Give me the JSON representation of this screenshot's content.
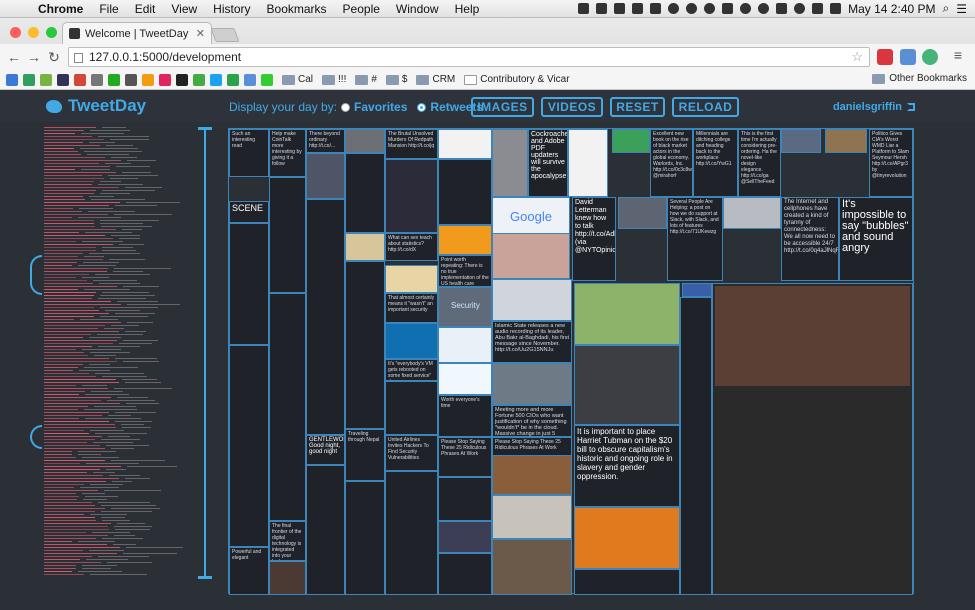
{
  "menubar": {
    "app": "Chrome",
    "items": [
      "File",
      "Edit",
      "View",
      "History",
      "Bookmarks",
      "People",
      "Window",
      "Help"
    ],
    "clock": "May 14  2:40 PM"
  },
  "browser": {
    "tab_title": "Welcome | TweetDay",
    "url": "127.0.0.1:5000/development",
    "bookmarks": [
      "Cal",
      "!!!",
      "#",
      "$",
      "CRM",
      "Contributory & Vicar"
    ],
    "other_bookmarks": "Other Bookmarks"
  },
  "app": {
    "logo": "TweetDay",
    "display_label": "Display your day by:",
    "option_favorites": "Favorites",
    "option_retweets": "Retweets",
    "buttons": [
      "IMAGES",
      "VIDEOS",
      "RESET",
      "RELOAD"
    ],
    "username": "danielsgriffin"
  },
  "tiles": {
    "t1": "Such an interesting read",
    "t2": "Help make CoinTalk more interesting by giving it a follow",
    "t3": "There beyond ordinary http://t.co/...",
    "t4": "The Brutal Unsolved Murders Of Redpath Mansion http://t.co/jq",
    "t5": "Cockroaches and Adobe PDF updaters will survive the apocalypse",
    "t6": "Excellent new book on the rise of black market actors in the global economy. Warlords, Inc. http://t.co/0c3c8w @mirahorf",
    "t7": "Millennials are ditching college and heading back to the workplace http://t.co/YwG1",
    "t8": "This is the first time I'm actually considering pre-ordering. Ha the novel-like design elegance. http://t.co/ga @SellTheFeed",
    "t9": "Politico Gives CIA's Worst WMD Liar a Platform to Slam Seymour Hersh http://t.co/APgr3 by @tinyrevolution",
    "t10": "David Letterman knew how to talk http://t.co/Adk (via @NYTOpinio",
    "t11": "Several People Are Helping: a post on how we do support at Slack, with Slack, and lots of features http://t.co/71UKewzg",
    "t12": "The Internet and cellphones have created a kind of tyranny of connectedness: We all now need to be accessible 24/7 http://t.co/0q4aJlNqR",
    "t13": "It's impossible to say \"bubbles\" and sound angry",
    "t14": "SCENE",
    "t15": "What can sex teach about statistics? http://t.co/dX",
    "t16": "Point worth repeating: There is no true implementation of the US health care system",
    "t17": "That almost certainly means it \"wasn't\" an important security",
    "t18": "Security",
    "t19": "Islamic State releases a new audio recording of its leader, Abu Bakr al-Baghdadi, his first message since November. http://t.co/Uu2G15NNJu",
    "t20": "It is important to place Harriet Tubman on the $20 bill to obscure capitalism's historic and ongoing role in slavery and gender oppression.",
    "t21": "Meeting more and more Fortune 500 CIOs who want justification of why something *wouldn't* be in the cloud. Massive change in just 5 years.",
    "t22": "Please Stop Saying These 25 Ridiculous Phrases At Work",
    "t23": "GENTLEWOM Good night, good night",
    "t24": "Worth everyone's time",
    "t25": "United Airlines Invites Hackers To Find Security Vulnerabilities",
    "t26": "It's \"everybody's VM gets rebooted on some fixed service\" day",
    "t27": "The final frontier of the digital technology is integrated into your body",
    "t28": "Powerful and elegant",
    "t29": "Traveling through Nepal"
  }
}
